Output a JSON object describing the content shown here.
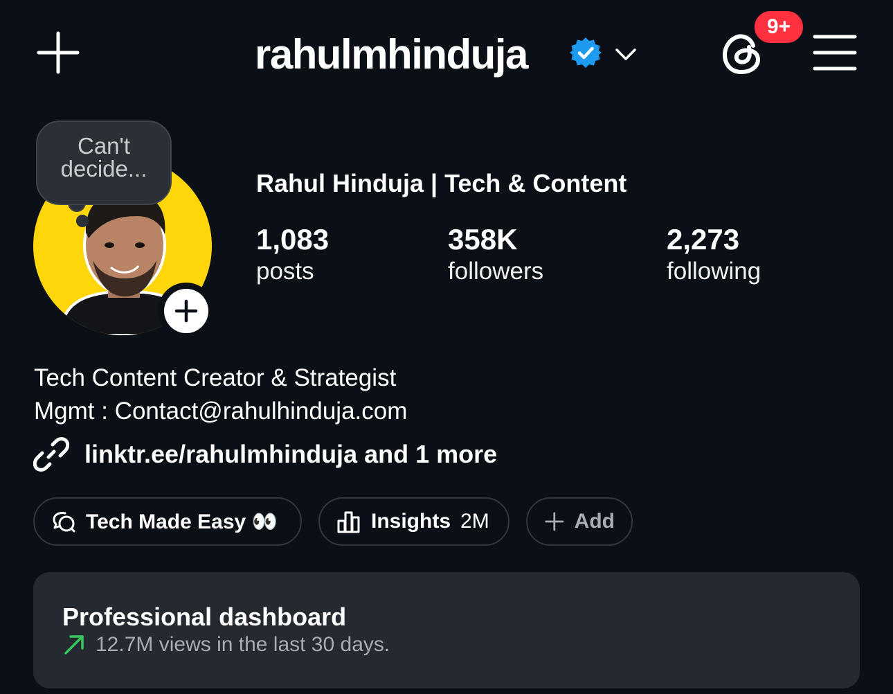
{
  "header": {
    "username": "rahulmhinduja",
    "notification_badge": "9+",
    "icons": [
      "plus-icon",
      "verified-badge-icon",
      "chevron-down-icon",
      "threads-icon",
      "menu-icon"
    ]
  },
  "profile": {
    "note": "Can't decide...",
    "display_name": "Rahul Hinduja | Tech & Content",
    "stats": [
      {
        "value": "1,083",
        "label": "posts"
      },
      {
        "value": "358K",
        "label": "followers"
      },
      {
        "value": "2,273",
        "label": "following"
      }
    ],
    "bio_lines": [
      "Tech Content Creator & Strategist",
      "Mgmt : Contact@rahulhinduja.com"
    ],
    "link": "linktr.ee/rahulmhinduja and 1 more"
  },
  "pills": {
    "channel": "Tech Made Easy 👀",
    "insights_label": "Insights",
    "insights_value": "2M",
    "add_label": "Add"
  },
  "dashboard": {
    "title": "Professional dashboard",
    "subtitle": "12.7M views in the last 30 days."
  },
  "colors": {
    "background": "#0b0f16",
    "badge": "#ff3040",
    "verified": "#1d9bf0",
    "avatar_ring": "#ffd60a",
    "trend": "#34c759",
    "card": "#252930"
  }
}
